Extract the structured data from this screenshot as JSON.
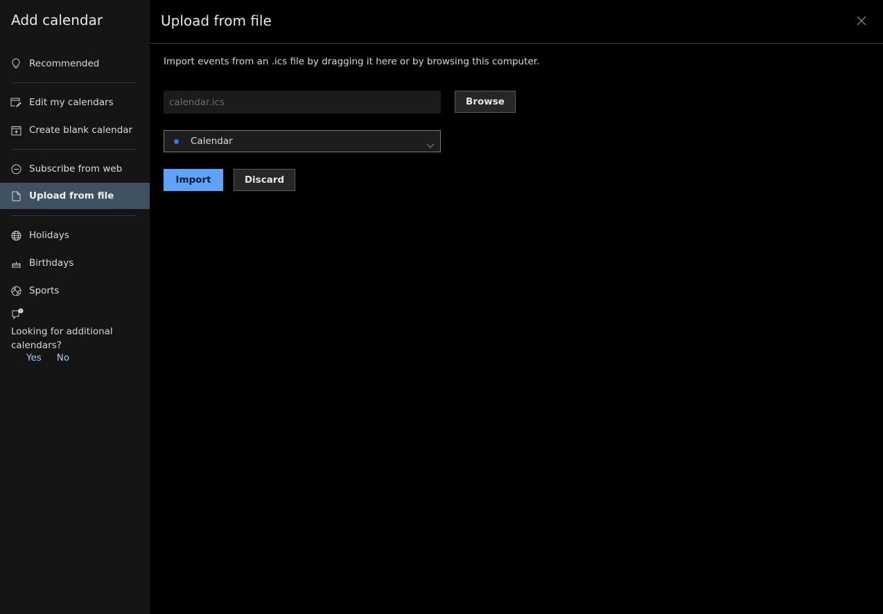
{
  "sidebar": {
    "title": "Add calendar",
    "items": [
      {
        "id": "recommended",
        "label": "Recommended",
        "icon": "lightbulb-icon",
        "active": false
      },
      {
        "id": "edit-my-calendars",
        "label": "Edit my calendars",
        "icon": "edit-calendar-icon",
        "active": false
      },
      {
        "id": "create-blank-calendar",
        "label": "Create blank calendar",
        "icon": "add-calendar-icon",
        "active": false
      },
      {
        "id": "subscribe-from-web",
        "label": "Subscribe from web",
        "icon": "link-circle-icon",
        "active": false
      },
      {
        "id": "upload-from-file",
        "label": "Upload from file",
        "icon": "file-upload-icon",
        "active": true
      },
      {
        "id": "holidays",
        "label": "Holidays",
        "icon": "globe-icon",
        "active": false
      },
      {
        "id": "birthdays",
        "label": "Birthdays",
        "icon": "cake-icon",
        "active": false
      },
      {
        "id": "sports",
        "label": "Sports",
        "icon": "sports-ball-icon",
        "active": false
      }
    ],
    "feedback": {
      "icon": "feedback-icon",
      "question": "Looking for additional calendars?",
      "yes_label": "Yes",
      "no_label": "No"
    }
  },
  "main": {
    "title": "Upload from file",
    "close_icon": "close-icon",
    "description": "Import events from an .ics file by dragging it here or by browsing this computer.",
    "file_input": {
      "value": "",
      "placeholder": "calendar.ics"
    },
    "browse_label": "Browse",
    "calendar_select": {
      "selected": "Calendar",
      "dot_color": "#2f7de0"
    },
    "import_label": "Import",
    "discard_label": "Discard"
  },
  "colors": {
    "accent": "#5ea3f7",
    "active_nav": "#3f5060",
    "link": "#a9c8f0"
  }
}
